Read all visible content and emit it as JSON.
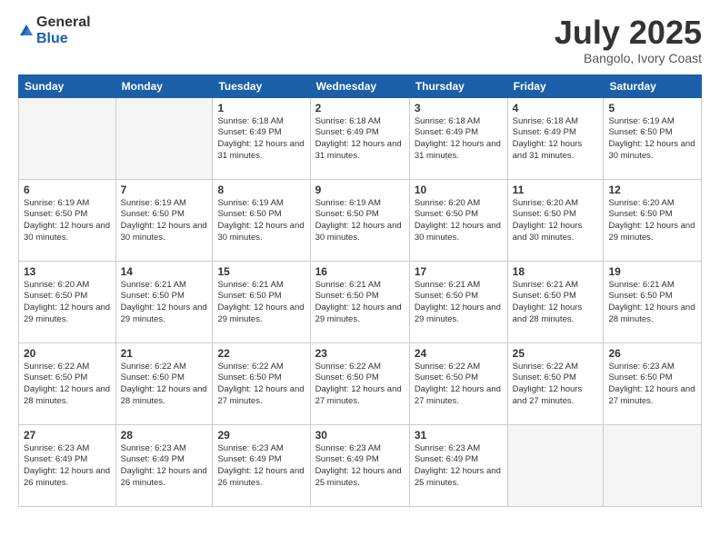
{
  "logo": {
    "general": "General",
    "blue": "Blue"
  },
  "title": {
    "month": "July 2025",
    "location": "Bangolo, Ivory Coast"
  },
  "weekdays": [
    "Sunday",
    "Monday",
    "Tuesday",
    "Wednesday",
    "Thursday",
    "Friday",
    "Saturday"
  ],
  "weeks": [
    [
      {
        "day": "",
        "info": ""
      },
      {
        "day": "",
        "info": ""
      },
      {
        "day": "1",
        "info": "Sunrise: 6:18 AM\nSunset: 6:49 PM\nDaylight: 12 hours and 31 minutes."
      },
      {
        "day": "2",
        "info": "Sunrise: 6:18 AM\nSunset: 6:49 PM\nDaylight: 12 hours and 31 minutes."
      },
      {
        "day": "3",
        "info": "Sunrise: 6:18 AM\nSunset: 6:49 PM\nDaylight: 12 hours and 31 minutes."
      },
      {
        "day": "4",
        "info": "Sunrise: 6:18 AM\nSunset: 6:49 PM\nDaylight: 12 hours and 31 minutes."
      },
      {
        "day": "5",
        "info": "Sunrise: 6:19 AM\nSunset: 6:50 PM\nDaylight: 12 hours and 30 minutes."
      }
    ],
    [
      {
        "day": "6",
        "info": "Sunrise: 6:19 AM\nSunset: 6:50 PM\nDaylight: 12 hours and 30 minutes."
      },
      {
        "day": "7",
        "info": "Sunrise: 6:19 AM\nSunset: 6:50 PM\nDaylight: 12 hours and 30 minutes."
      },
      {
        "day": "8",
        "info": "Sunrise: 6:19 AM\nSunset: 6:50 PM\nDaylight: 12 hours and 30 minutes."
      },
      {
        "day": "9",
        "info": "Sunrise: 6:19 AM\nSunset: 6:50 PM\nDaylight: 12 hours and 30 minutes."
      },
      {
        "day": "10",
        "info": "Sunrise: 6:20 AM\nSunset: 6:50 PM\nDaylight: 12 hours and 30 minutes."
      },
      {
        "day": "11",
        "info": "Sunrise: 6:20 AM\nSunset: 6:50 PM\nDaylight: 12 hours and 30 minutes."
      },
      {
        "day": "12",
        "info": "Sunrise: 6:20 AM\nSunset: 6:50 PM\nDaylight: 12 hours and 29 minutes."
      }
    ],
    [
      {
        "day": "13",
        "info": "Sunrise: 6:20 AM\nSunset: 6:50 PM\nDaylight: 12 hours and 29 minutes."
      },
      {
        "day": "14",
        "info": "Sunrise: 6:21 AM\nSunset: 6:50 PM\nDaylight: 12 hours and 29 minutes."
      },
      {
        "day": "15",
        "info": "Sunrise: 6:21 AM\nSunset: 6:50 PM\nDaylight: 12 hours and 29 minutes."
      },
      {
        "day": "16",
        "info": "Sunrise: 6:21 AM\nSunset: 6:50 PM\nDaylight: 12 hours and 29 minutes."
      },
      {
        "day": "17",
        "info": "Sunrise: 6:21 AM\nSunset: 6:50 PM\nDaylight: 12 hours and 29 minutes."
      },
      {
        "day": "18",
        "info": "Sunrise: 6:21 AM\nSunset: 6:50 PM\nDaylight: 12 hours and 28 minutes."
      },
      {
        "day": "19",
        "info": "Sunrise: 6:21 AM\nSunset: 6:50 PM\nDaylight: 12 hours and 28 minutes."
      }
    ],
    [
      {
        "day": "20",
        "info": "Sunrise: 6:22 AM\nSunset: 6:50 PM\nDaylight: 12 hours and 28 minutes."
      },
      {
        "day": "21",
        "info": "Sunrise: 6:22 AM\nSunset: 6:50 PM\nDaylight: 12 hours and 28 minutes."
      },
      {
        "day": "22",
        "info": "Sunrise: 6:22 AM\nSunset: 6:50 PM\nDaylight: 12 hours and 27 minutes."
      },
      {
        "day": "23",
        "info": "Sunrise: 6:22 AM\nSunset: 6:50 PM\nDaylight: 12 hours and 27 minutes."
      },
      {
        "day": "24",
        "info": "Sunrise: 6:22 AM\nSunset: 6:50 PM\nDaylight: 12 hours and 27 minutes."
      },
      {
        "day": "25",
        "info": "Sunrise: 6:22 AM\nSunset: 6:50 PM\nDaylight: 12 hours and 27 minutes."
      },
      {
        "day": "26",
        "info": "Sunrise: 6:23 AM\nSunset: 6:50 PM\nDaylight: 12 hours and 27 minutes."
      }
    ],
    [
      {
        "day": "27",
        "info": "Sunrise: 6:23 AM\nSunset: 6:49 PM\nDaylight: 12 hours and 26 minutes."
      },
      {
        "day": "28",
        "info": "Sunrise: 6:23 AM\nSunset: 6:49 PM\nDaylight: 12 hours and 26 minutes."
      },
      {
        "day": "29",
        "info": "Sunrise: 6:23 AM\nSunset: 6:49 PM\nDaylight: 12 hours and 26 minutes."
      },
      {
        "day": "30",
        "info": "Sunrise: 6:23 AM\nSunset: 6:49 PM\nDaylight: 12 hours and 25 minutes."
      },
      {
        "day": "31",
        "info": "Sunrise: 6:23 AM\nSunset: 6:49 PM\nDaylight: 12 hours and 25 minutes."
      },
      {
        "day": "",
        "info": ""
      },
      {
        "day": "",
        "info": ""
      }
    ]
  ]
}
